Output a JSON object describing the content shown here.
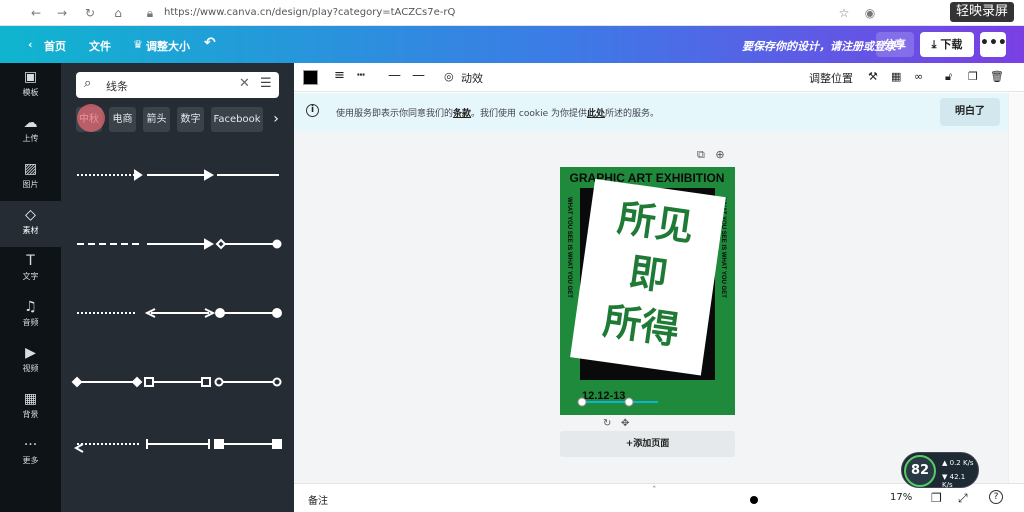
{
  "browser": {
    "url": "https://www.canva.cn/design/play?category=tACZCs7e-rQ",
    "recorder": "轻映录屏"
  },
  "topbar": {
    "home": "首页",
    "file": "文件",
    "resize": "调整大小",
    "promo": "要保存你的设计，请注册或登录",
    "share": "分享",
    "download": "下载",
    "more": "•••"
  },
  "rail": [
    {
      "icon": "template-icon",
      "glyph": "▣",
      "label": "模板"
    },
    {
      "icon": "upload-icon",
      "glyph": "☁",
      "label": "上传"
    },
    {
      "icon": "photo-icon",
      "glyph": "▨",
      "label": "图片"
    },
    {
      "icon": "elements-icon",
      "glyph": "◇",
      "label": "素材"
    },
    {
      "icon": "text-icon",
      "glyph": "T",
      "label": "文字"
    },
    {
      "icon": "audio-icon",
      "glyph": "♫",
      "label": "音频"
    },
    {
      "icon": "video-icon",
      "glyph": "▶",
      "label": "视频"
    },
    {
      "icon": "background-icon",
      "glyph": "▦",
      "label": "背景"
    },
    {
      "icon": "more-icon",
      "glyph": "···",
      "label": "更多"
    }
  ],
  "panel": {
    "search_value": "线条",
    "chips": [
      "中秋",
      "电商",
      "箭头",
      "数字",
      "Facebook"
    ]
  },
  "toolbar": {
    "animate": "动效",
    "position": "调整位置"
  },
  "cookie": {
    "text_a": "使用服务即表示你同意我们的",
    "terms": "条款",
    "text_b": "。我们使用 cookie 为你提供",
    "here": "此处",
    "text_c": "所述的服务。",
    "button": "明白了"
  },
  "poster": {
    "title": "GRAPHIC ART EXHIBITION",
    "main": [
      "所见",
      "即",
      "所得"
    ],
    "side": "WHAT YOU SEE IS WHAT YOU GET",
    "date": "12.12-13",
    "bg": "#1f8a3b"
  },
  "canvas": {
    "add_page": "+添加页面"
  },
  "bottom": {
    "notes": "备注",
    "zoom": "17%"
  },
  "speed": {
    "percent": "82",
    "up": "0.2",
    "down": "42.1",
    "unit": "K/s"
  }
}
